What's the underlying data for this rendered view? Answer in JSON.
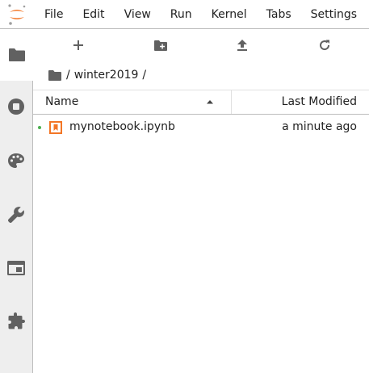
{
  "menu": {
    "items": [
      {
        "label": "File"
      },
      {
        "label": "Edit"
      },
      {
        "label": "View"
      },
      {
        "label": "Run"
      },
      {
        "label": "Kernel"
      },
      {
        "label": "Tabs"
      },
      {
        "label": "Settings"
      }
    ]
  },
  "sidebar": {
    "tabs": [
      {
        "icon": "folder-icon",
        "active": true
      },
      {
        "icon": "stop-circle-icon",
        "active": false
      },
      {
        "icon": "palette-icon",
        "active": false
      },
      {
        "icon": "wrench-icon",
        "active": false
      },
      {
        "icon": "tab-window-icon",
        "active": false
      },
      {
        "icon": "extension-puzzle-icon",
        "active": false
      }
    ]
  },
  "toolbar": {
    "buttons": [
      {
        "icon": "plus-icon"
      },
      {
        "icon": "new-folder-icon"
      },
      {
        "icon": "upload-icon"
      },
      {
        "icon": "refresh-icon"
      }
    ]
  },
  "breadcrumb": {
    "root_icon": "folder-icon",
    "separator": "/",
    "current": "winter2019",
    "trailing": "/"
  },
  "file_list": {
    "columns": {
      "name": "Name",
      "last_modified": "Last Modified"
    },
    "sort": "ascending",
    "rows": [
      {
        "name": "mynotebook.ipynb",
        "modified": "a minute ago",
        "icon": "notebook-icon",
        "running": true
      }
    ]
  },
  "colors": {
    "accent": "#f37626",
    "running": "#4caf50",
    "sidebar_bg": "#eeeeee",
    "icon": "#616161"
  }
}
